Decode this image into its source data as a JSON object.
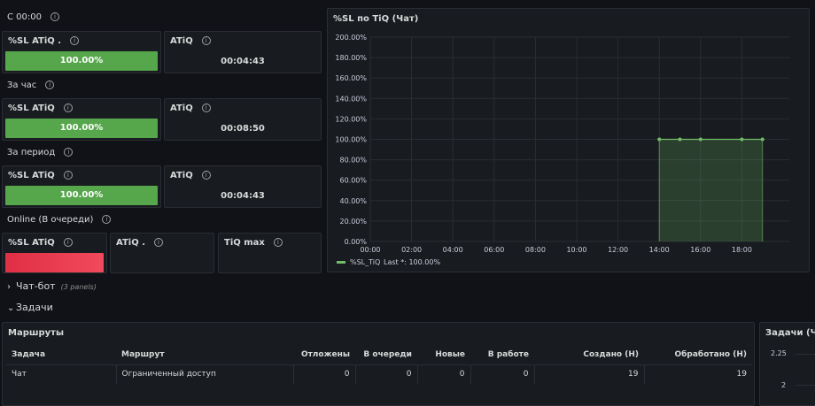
{
  "groups": {
    "g1": {
      "label": "С 00:00",
      "sl_title": "%SL ATiQ .",
      "sl_value": "100.00%",
      "atiq_title": "ATiQ",
      "atiq_value": "00:04:43"
    },
    "g2": {
      "label": "За час",
      "sl_title": "%SL ATiQ",
      "sl_value": "100.00%",
      "atiq_title": "ATiQ",
      "atiq_value": "00:08:50"
    },
    "g3": {
      "label": "За период",
      "sl_title": "%SL ATiQ",
      "sl_value": "100.00%",
      "atiq_title": "ATiQ",
      "atiq_value": "00:04:43"
    },
    "g4": {
      "label": "Online (В очереди)",
      "sl_title": "%SL ATiQ",
      "atiq_title": "ATiQ .",
      "tiq_title": "TiQ max"
    }
  },
  "colors": {
    "good": "#56a64b",
    "bad": "#e02f44",
    "series": "#73bf69"
  },
  "sections": {
    "chatbot": {
      "label": "Чат-бот",
      "meta": "(3 panels)",
      "chevron": "›"
    },
    "tasks": {
      "label": "Задачи",
      "chevron": "⌄"
    }
  },
  "routes": {
    "title": "Маршруты",
    "columns": [
      "Задача",
      "Маршрут",
      "Отложены",
      "В очереди",
      "Новые",
      "В работе",
      "Создано (Н)",
      "Обработано (Н)"
    ],
    "rows": [
      [
        "Чат",
        "Ограниченный доступ",
        "0",
        "0",
        "0",
        "0",
        "19",
        "19"
      ]
    ]
  },
  "tasks_panel": {
    "title": "Задачи (Чат",
    "ticks": [
      "2.25",
      "2"
    ]
  },
  "chart_data": {
    "type": "area",
    "title": "%SL по TiQ (Чат)",
    "xlabel": "",
    "ylabel": "",
    "x_ticks": [
      "00:00",
      "02:00",
      "04:00",
      "06:00",
      "08:00",
      "10:00",
      "12:00",
      "14:00",
      "16:00",
      "18:00"
    ],
    "y_ticks": [
      "0.00%",
      "20.00%",
      "40.00%",
      "60.00%",
      "80.00%",
      "100.00%",
      "120.00%",
      "140.00%",
      "160.00%",
      "180.00%",
      "200.00%"
    ],
    "xlim": [
      0,
      20.3
    ],
    "ylim": [
      0,
      200
    ],
    "series": [
      {
        "name": "%SL_TiQ",
        "x": [
          14,
          15,
          16,
          18,
          19
        ],
        "values": [
          100,
          100,
          100,
          100,
          100
        ]
      }
    ],
    "legend": {
      "label": "%SL_TiQ",
      "calc": "Last *: 100.00%",
      "placement": "bottom-left"
    },
    "grid": true
  }
}
